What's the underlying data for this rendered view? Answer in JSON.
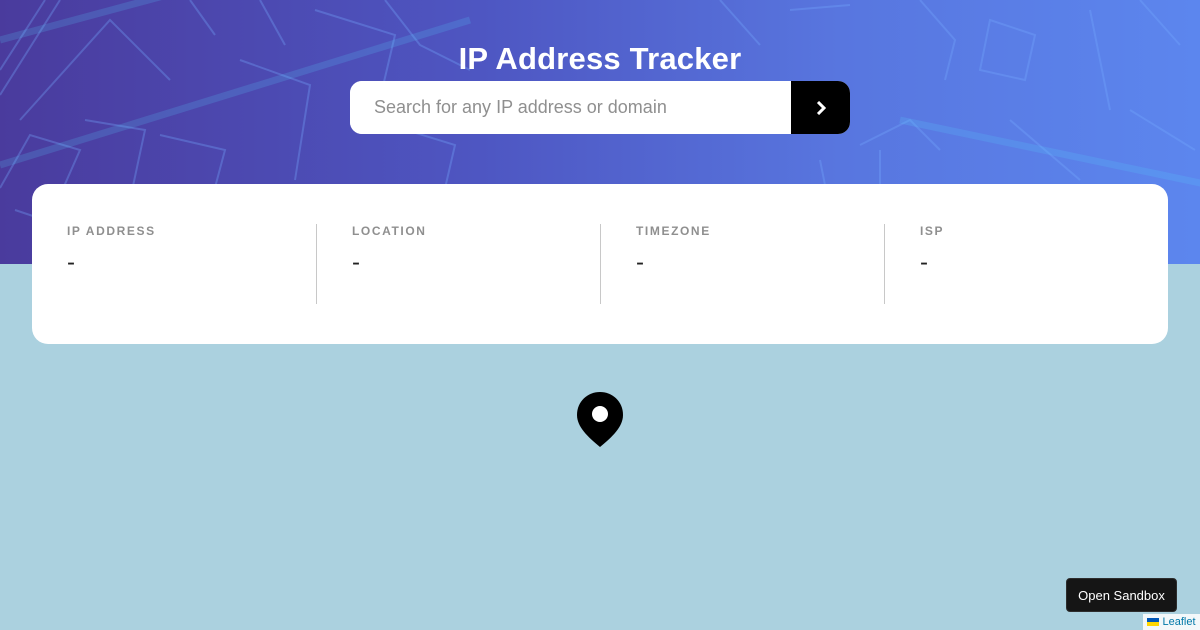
{
  "app": {
    "title": "IP Address Tracker"
  },
  "search": {
    "placeholder": "Search for any IP address or domain",
    "value": "",
    "button_icon": "chevron-right-icon"
  },
  "info": {
    "items": [
      {
        "label": "IP ADDRESS",
        "value": "-"
      },
      {
        "label": "LOCATION",
        "value": "-"
      },
      {
        "label": "TIMEZONE",
        "value": "-"
      },
      {
        "label": "ISP",
        "value": "-"
      }
    ]
  },
  "map": {
    "marker_icon": "location-pin-icon",
    "background_color": "#abd1df"
  },
  "sandbox": {
    "button_label": "Open Sandbox"
  },
  "attribution": {
    "label": "Leaflet",
    "flag_icon": "ukraine-flag-icon"
  },
  "colors": {
    "header_gradient_start": "#4a3b9d",
    "header_gradient_end": "#5c86ee",
    "search_button": "#000000",
    "card_background": "#ffffff"
  }
}
